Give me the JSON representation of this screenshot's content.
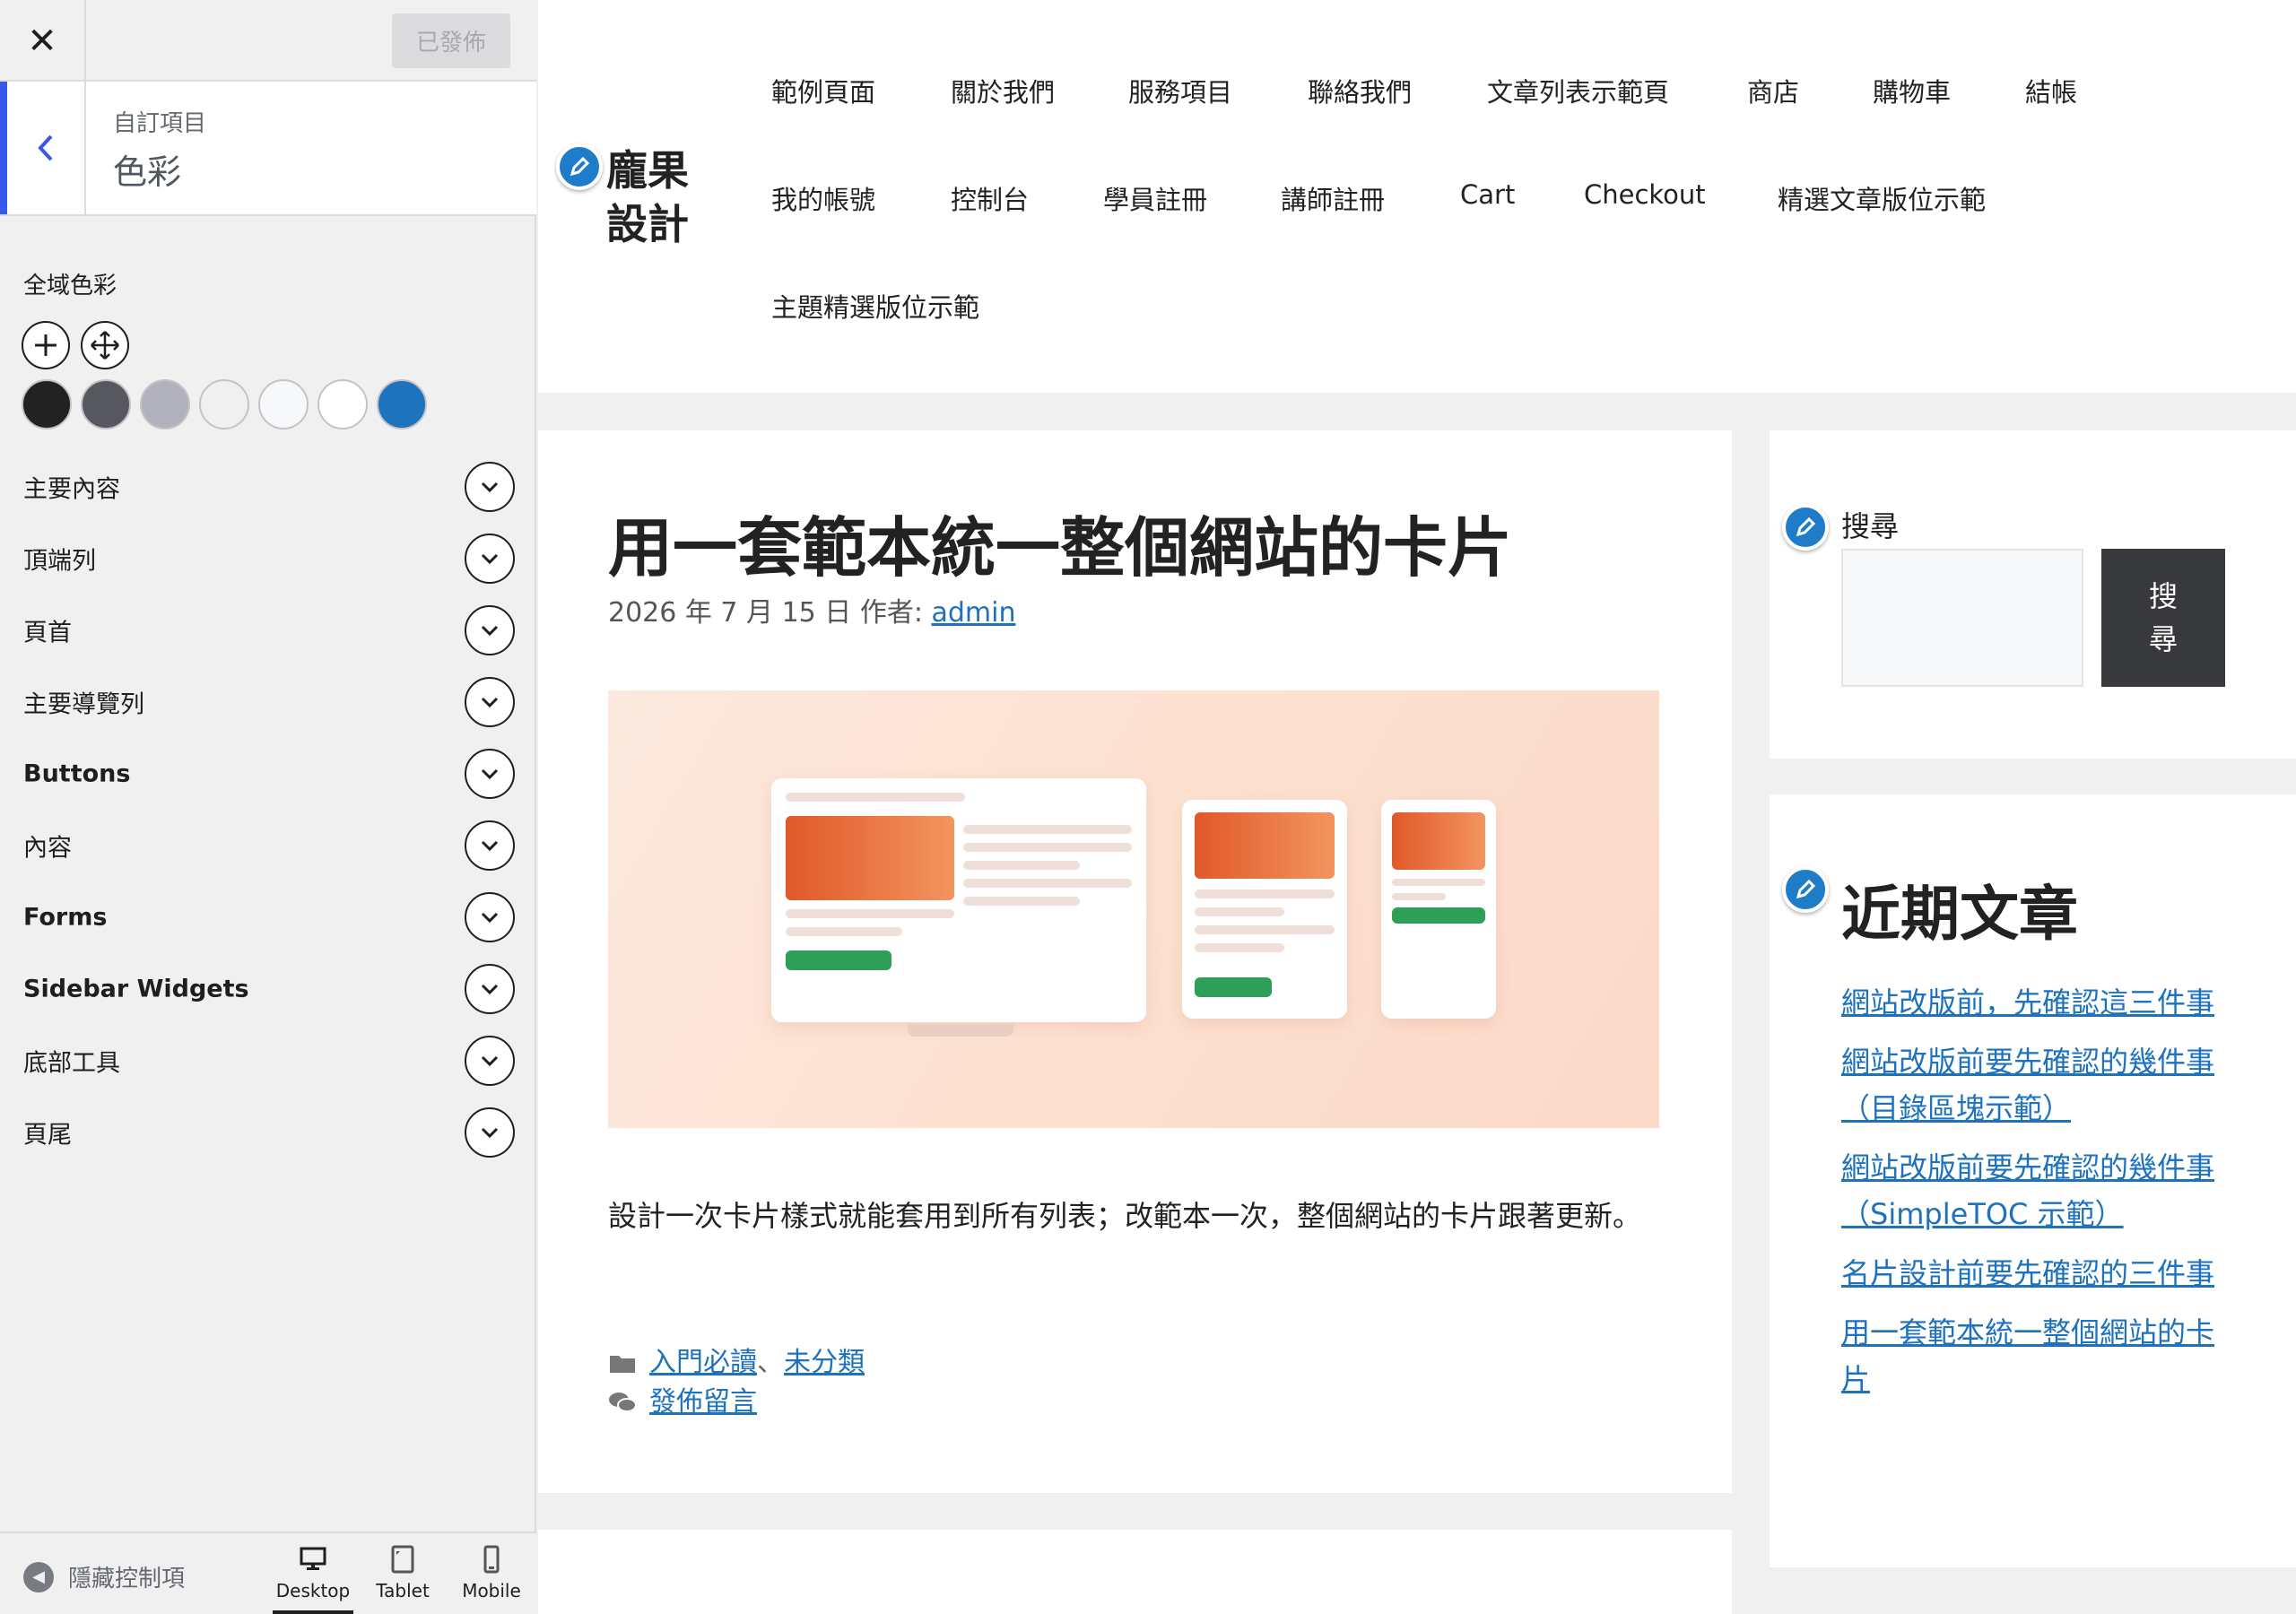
{
  "customizer": {
    "publish_label": "已發佈",
    "breadcrumb": "自訂項目",
    "section_title": "色彩",
    "global_colors_label": "全域色彩",
    "swatches": [
      "#222222",
      "#575760",
      "#b2b2be",
      "#f0f0f0",
      "#f7f8f9",
      "#ffffff",
      "#1e73be"
    ],
    "rows": [
      {
        "label": "主要內容",
        "bold": false
      },
      {
        "label": "頂端列",
        "bold": false
      },
      {
        "label": "頁首",
        "bold": false
      },
      {
        "label": "主要導覽列",
        "bold": false
      },
      {
        "label": "Buttons",
        "bold": true
      },
      {
        "label": "內容",
        "bold": false
      },
      {
        "label": "Forms",
        "bold": true
      },
      {
        "label": "Sidebar Widgets",
        "bold": true
      },
      {
        "label": "底部工具",
        "bold": false
      },
      {
        "label": "頁尾",
        "bold": false
      }
    ],
    "hide_controls_label": "隱藏控制項",
    "devices": [
      "Desktop",
      "Tablet",
      "Mobile"
    ],
    "active_device": "Desktop",
    "accent_color": "#3858e9"
  },
  "site": {
    "title": "龐果設計",
    "nav": [
      "範例頁面",
      "關於我們",
      "服務項目",
      "聯絡我們",
      "文章列表示範頁",
      "商店",
      "購物車",
      "結帳",
      "我的帳號",
      "控制台",
      "學員註冊",
      "講師註冊",
      "Cart",
      "Checkout",
      "精選文章版位示範",
      "主題精選版位示範"
    ],
    "link_color": "#1e72bd"
  },
  "post": {
    "title": "用一套範本統一整個網站的卡片",
    "meta_prefix": "2026 年 7 月 15 日 作者: ",
    "author": "admin",
    "excerpt": "設計一次卡片樣式就能套用到所有列表；改範本一次，整個網站的卡片跟著更新。",
    "category_1": "入門必讀",
    "category_sep": "、",
    "category_2": "未分類",
    "comments_link": "發佈留言"
  },
  "second_post": {
    "title": "網站改版前，先確認這三件事"
  },
  "sidebar": {
    "search_label": "搜尋",
    "search_button": "搜尋",
    "recent_title": "近期文章",
    "recent_posts": [
      "網站改版前，先確認這三件事",
      "網站改版前要先確認的幾件事（目錄區塊示範）",
      "網站改版前要先確認的幾件事（SimpleTOC 示範）",
      "名片設計前要先確認的三件事",
      "用一套範本統一整個網站的卡片"
    ]
  }
}
